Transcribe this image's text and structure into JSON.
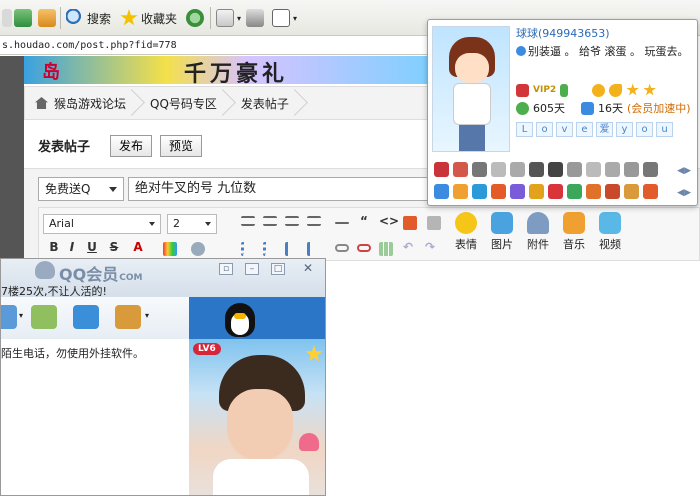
{
  "toolbar": {
    "search_label": "搜索",
    "favorites_label": "收藏夹"
  },
  "address": {
    "url": "s.houdao.com/post.php?fid=778"
  },
  "banner": {
    "text_left": "岛",
    "text_right": "千万豪礼"
  },
  "breadcrumb": {
    "items": [
      "猴岛游戏论坛",
      "QQ号码专区",
      "发表帖子"
    ]
  },
  "post": {
    "heading": "发表帖子",
    "publish_label": "发布",
    "preview_label": "预览"
  },
  "form": {
    "category_value": "免费送Q",
    "subject_value": "绝对牛叉的号 九位数"
  },
  "editor": {
    "font_value": "Arial",
    "size_value": "2",
    "tools": [
      {
        "label": "表情",
        "color": "#f5c518"
      },
      {
        "label": "图片",
        "color": "#4aa3df"
      },
      {
        "label": "附件",
        "color": "#7e9cc2"
      },
      {
        "label": "音乐",
        "color": "#f0a030"
      },
      {
        "label": "视频",
        "color": "#59b8e6"
      }
    ]
  },
  "qq_window": {
    "logo": "QQ会员",
    "logo_suffix": "COM",
    "signature": "7楼25次,不让人活的!",
    "message": "陌生电话，勿使用外挂软件。",
    "level_badge": "LV6"
  },
  "profile": {
    "name": "球球(949943653)",
    "signature": "别装逼 。 给爷 滚蛋 。 玩蛋去。",
    "vip": "VIP2",
    "days_online": "605天",
    "days_remaining": "16天",
    "speed_note": "(会员加速中)",
    "love_chars": [
      "L",
      "o",
      "v",
      "e",
      "爱",
      "y",
      "o",
      "u"
    ]
  },
  "colors": {
    "link_blue": "#2a6ab8",
    "vip_gold": "#c59000",
    "speed_orange": "#d06a00"
  }
}
